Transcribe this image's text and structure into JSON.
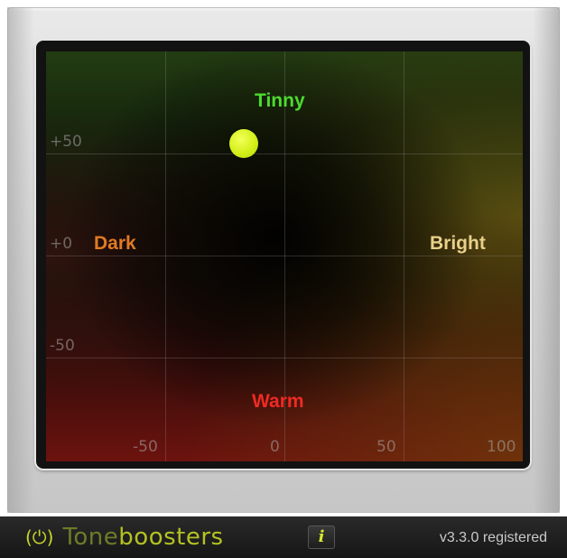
{
  "pad": {
    "x_ticks": [
      "-50",
      "0",
      "50",
      "100"
    ],
    "y_ticks": [
      "+50",
      "+0",
      "-50"
    ],
    "labels": {
      "top": "Tinny",
      "left": "Dark",
      "right": "Bright",
      "bottom": "Warm"
    },
    "colors": {
      "tinny": "#4cdc2e",
      "dark": "#e07a25",
      "bright": "#e8d08a",
      "warm": "#ef2a24",
      "handle": "#d4f019"
    },
    "handle_value": {
      "x": -17,
      "y": 55
    }
  },
  "footer": {
    "power_icon": "power-icon",
    "brand_part1": "Tone",
    "brand_part2": "boosters",
    "info_button": "i",
    "version": "v3.3.0 registered"
  }
}
